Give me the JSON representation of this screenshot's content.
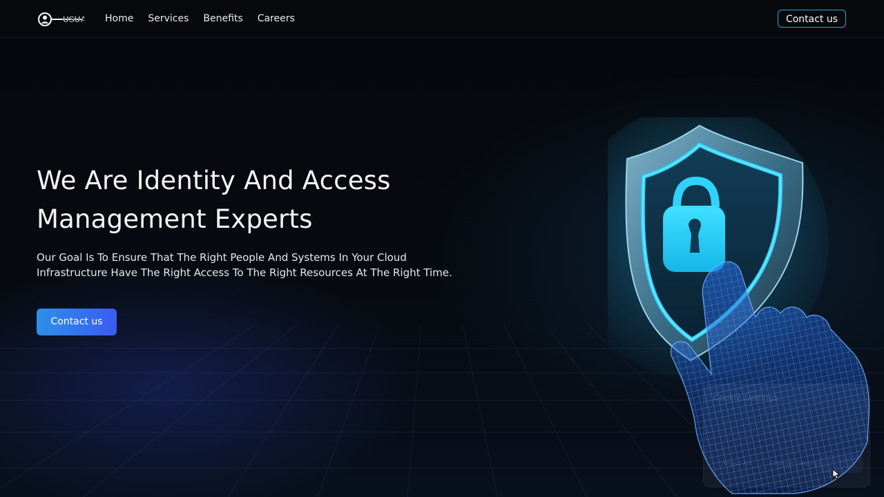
{
  "nav": {
    "logo_text": "USUA",
    "links": [
      {
        "label": "Home"
      },
      {
        "label": "Services"
      },
      {
        "label": "Benefits"
      },
      {
        "label": "Careers"
      }
    ],
    "contact_label": "Contact us"
  },
  "hero": {
    "title": "We Are Identity And Access Management Experts",
    "subtitle_line1": "Our Goal Is To Ensure That The Right People And Systems In Your Cloud",
    "subtitle_line2": "Infrastructure Have The Right Access To The Right Resources At The Right Time.",
    "cta_label": "Contact us"
  },
  "illustration": {
    "icons": [
      "shield-icon",
      "padlock-icon",
      "wireframe-hand-icon"
    ]
  },
  "cookie_dialog": {
    "title": "Cookie Settings",
    "reject_label": "Reject All",
    "change_label": "Change Settings",
    "accept_label": ""
  },
  "colors": {
    "accent": "#2aa9d9",
    "cta_start": "#2d8fe8",
    "cta_end": "#3a5cf0",
    "background": "#06080c",
    "shield_glow": "#27d4ff"
  }
}
